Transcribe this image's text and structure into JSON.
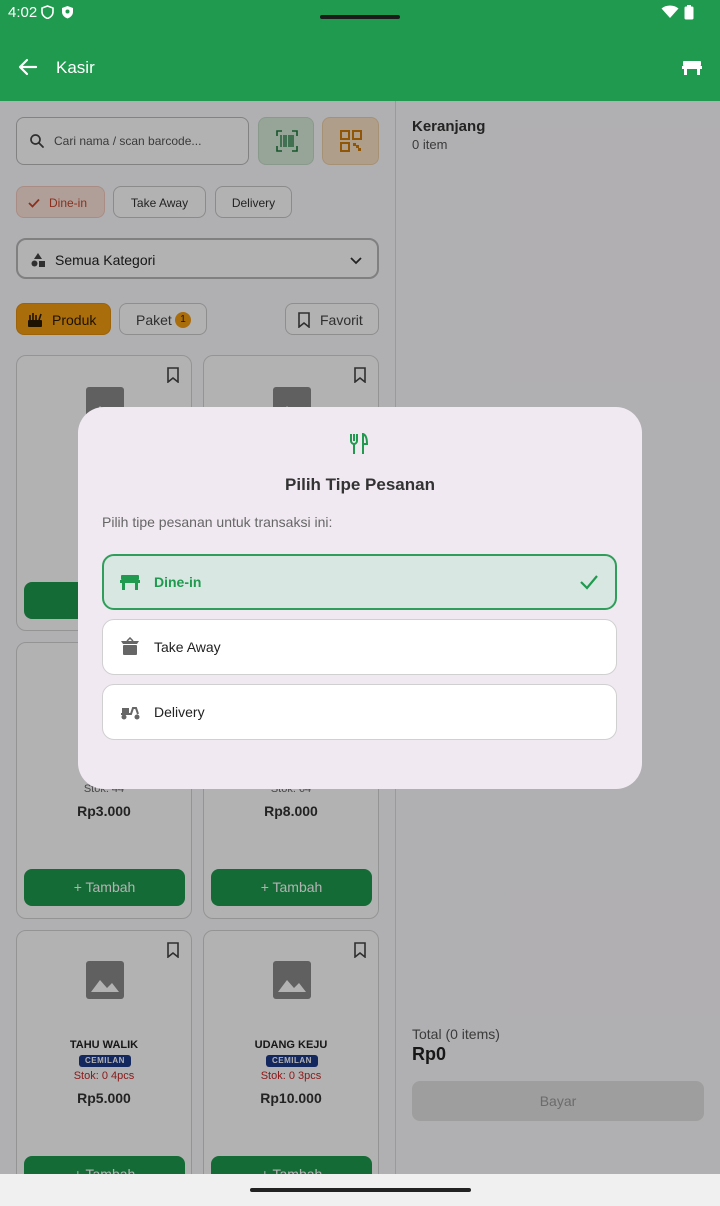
{
  "status_bar": {
    "time": "4:02"
  },
  "app_bar": {
    "title": "Kasir"
  },
  "search": {
    "placeholder": "Cari nama / scan barcode..."
  },
  "order_type_chips": [
    {
      "label": "Dine-in",
      "selected": true
    },
    {
      "label": "Take Away",
      "selected": false
    },
    {
      "label": "Delivery",
      "selected": false
    }
  ],
  "category_select": {
    "value": "Semua Kategori"
  },
  "tabs": {
    "produk": "Produk",
    "paket": "Paket",
    "paket_badge": "1",
    "favorit": "Favorit"
  },
  "products": [
    {
      "name": "",
      "category": "",
      "stock": "",
      "price": "",
      "add_label": "+"
    },
    {
      "name": "",
      "category": "",
      "stock": "",
      "price": "",
      "add_label": ""
    },
    {
      "name": "",
      "category": "",
      "stock": "Stok: 44",
      "price": "Rp3.000",
      "add_label": "+ Tambah"
    },
    {
      "name": "",
      "category": "",
      "stock": "Stok: 64",
      "price": "Rp8.000",
      "add_label": "+ Tambah"
    },
    {
      "name": "TAHU WALIK",
      "category": "CEMILAN",
      "stock": "Stok: 0 4pcs",
      "price": "Rp5.000",
      "add_label": "+ Tambah"
    },
    {
      "name": "UDANG KEJU",
      "category": "CEMILAN",
      "stock": "Stok: 0 3pcs",
      "price": "Rp10.000",
      "add_label": "+ Tambah"
    }
  ],
  "cart": {
    "title": "Keranjang",
    "count": "0 item",
    "total_label": "Total (0 items)",
    "total_value": "Rp0",
    "pay_label": "Bayar"
  },
  "dialog": {
    "icon": "restaurant-icon",
    "title": "Pilih Tipe Pesanan",
    "subtitle": "Pilih tipe pesanan untuk transaksi ini:",
    "options": [
      {
        "label": "Dine-in",
        "icon": "table-icon",
        "selected": true
      },
      {
        "label": "Take Away",
        "icon": "takeaway-box-icon",
        "selected": false
      },
      {
        "label": "Delivery",
        "icon": "scooter-icon",
        "selected": false
      }
    ]
  },
  "colors": {
    "primary": "#1f9a4e",
    "accent": "#f29c12",
    "dialog_bg": "#f0e9f1",
    "selected_bg": "#d8e7e2"
  }
}
